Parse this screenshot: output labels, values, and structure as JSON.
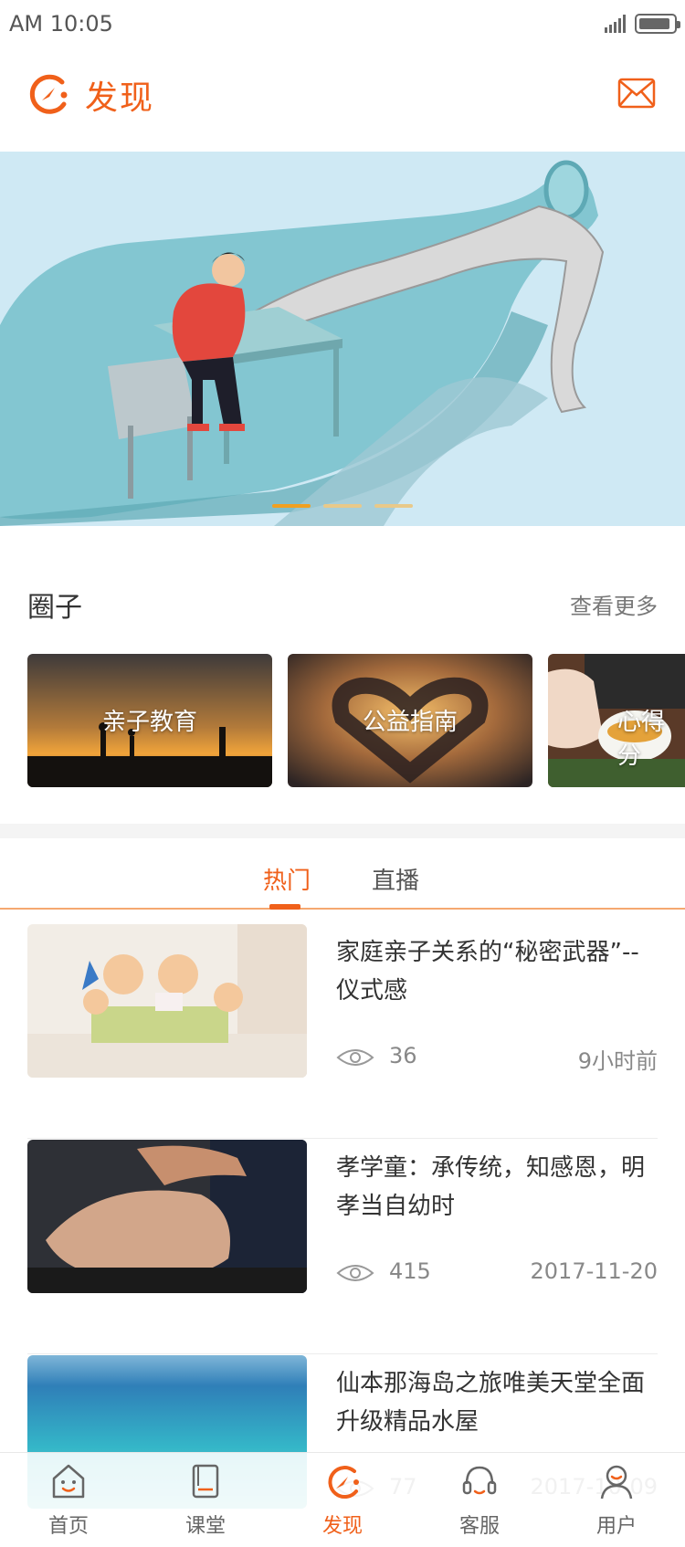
{
  "status_bar": {
    "time": "AM 10:05"
  },
  "header": {
    "title": "发现",
    "logo_icon": "compass-c-logo-icon",
    "mail_icon": "mail-icon"
  },
  "banner": {
    "slides": 3,
    "active_index": 0
  },
  "circles": {
    "title": "圈子",
    "more_label": "查看更多",
    "cards": [
      {
        "label": "亲子教育"
      },
      {
        "label": "公益指南"
      },
      {
        "label": "心得分"
      }
    ]
  },
  "tabs": [
    {
      "label": "热门",
      "active": true
    },
    {
      "label": "直播",
      "active": false
    }
  ],
  "articles": [
    {
      "title": "家庭亲子关系的“秘密武器”--仪式感",
      "views": "36",
      "time": "9小时前"
    },
    {
      "title": "孝学童：承传统，知感恩，明孝当自幼时",
      "views": "415",
      "time": "2017-11-20"
    },
    {
      "title": "仙本那海岛之旅唯美天堂全面升级精品水屋",
      "views": "77",
      "time": "2017-10-09"
    }
  ],
  "bottom_nav": [
    {
      "label": "首页",
      "icon": "home-face-icon",
      "active": false
    },
    {
      "label": "课堂",
      "icon": "book-icon",
      "active": false
    },
    {
      "label": "发现",
      "icon": "compass-c-icon",
      "active": true
    },
    {
      "label": "客服",
      "icon": "headset-icon",
      "active": false
    },
    {
      "label": "用户",
      "icon": "user-icon",
      "active": false
    }
  ],
  "colors": {
    "accent": "#f0601a",
    "banner_bg": "#cfe9f4"
  }
}
